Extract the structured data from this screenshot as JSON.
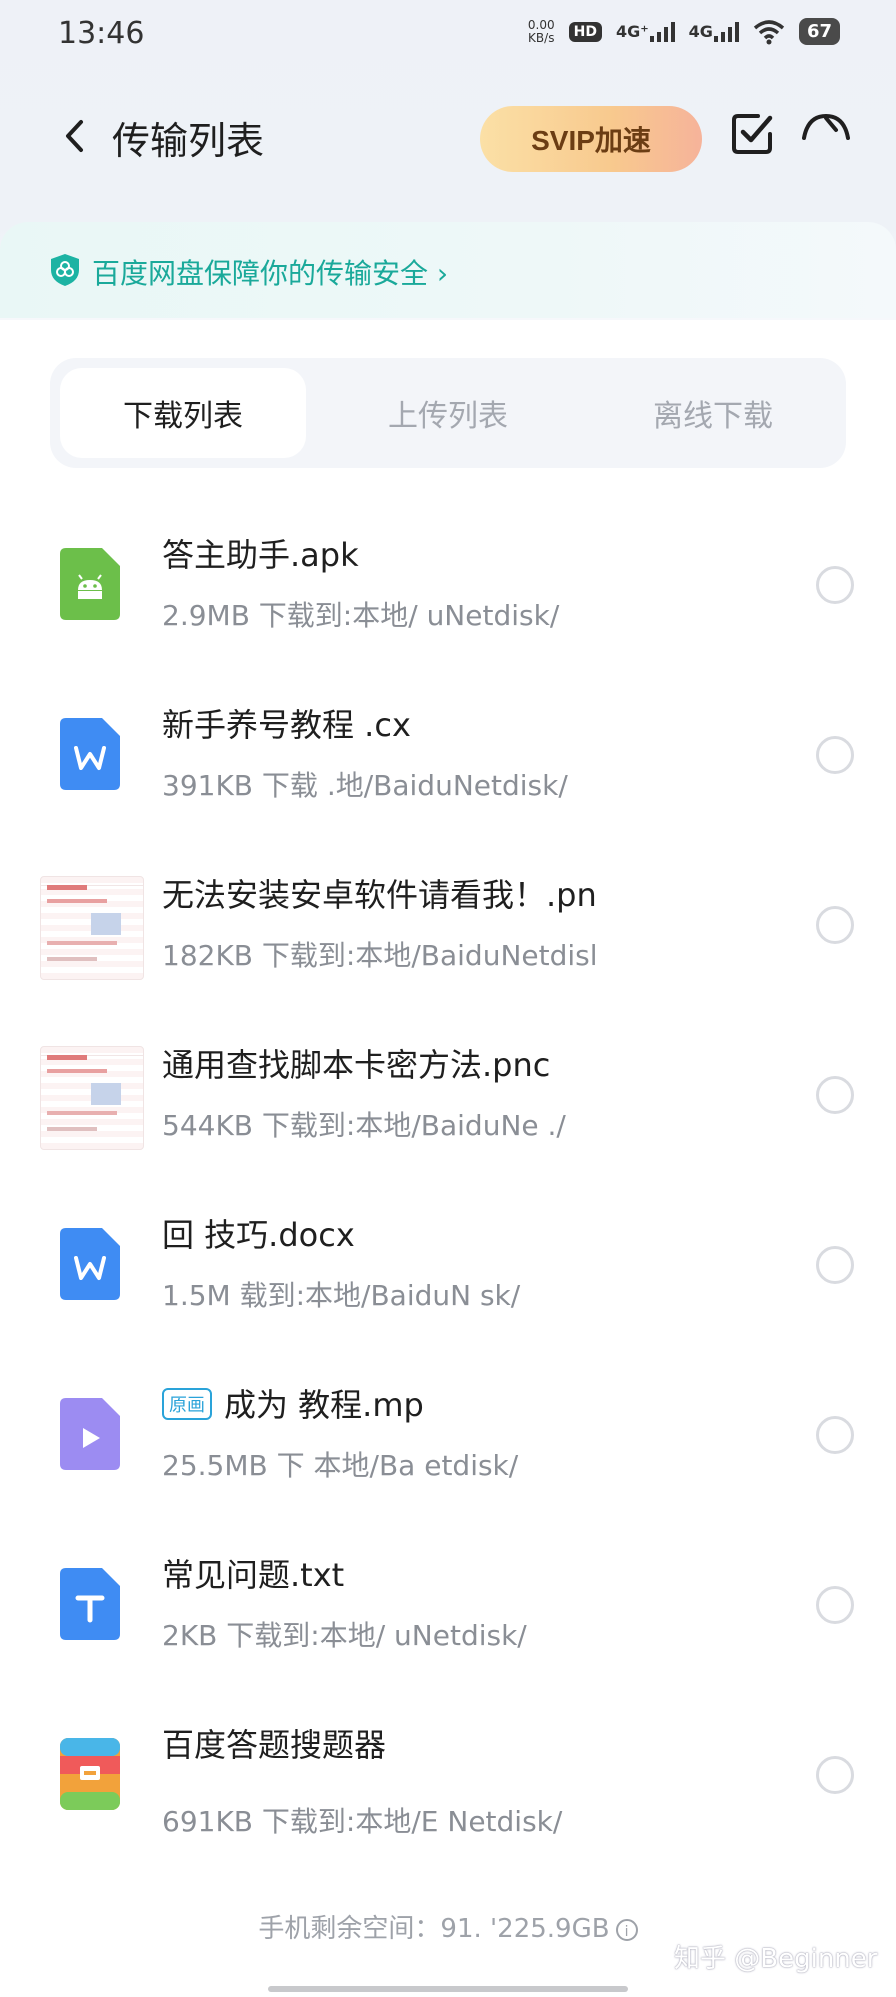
{
  "status_bar": {
    "time": "13:46",
    "net_speed_value": "0.00",
    "net_speed_unit": "KB/s",
    "hd_label": "HD",
    "signal1_label": "4G⁺",
    "signal2_label": "4G",
    "battery": "67"
  },
  "header": {
    "title": "传输列表",
    "svip_label": "SVIP加速"
  },
  "security_banner": {
    "text": "百度网盘保障你的传输安全 ›"
  },
  "tabs": [
    {
      "label": "下载列表",
      "active": true
    },
    {
      "label": "上传列表",
      "active": false
    },
    {
      "label": "离线下载",
      "active": false
    }
  ],
  "files": [
    {
      "name": "答主助手.apk",
      "meta": "2.9MB 下载到:本地/ uNetdisk/",
      "icon": "android-apk-icon",
      "color": "#6cbf4a"
    },
    {
      "name": "新手养号教程 .cx",
      "meta": "391KB 下载 .地/BaiduNetdisk/",
      "icon": "word-doc-icon",
      "color": "#3f8cf3"
    },
    {
      "name": "无法安装安卓软件请看我！.pn",
      "meta": "182KB 下载到:本地/BaiduNetdisl",
      "icon": "image-thumbnail",
      "color": "#e07b7b"
    },
    {
      "name": "通用查找脚本卡密方法.pnc",
      "meta": "544KB 下载到:本地/BaiduNe ./",
      "icon": "image-thumbnail",
      "color": "#e07b7b"
    },
    {
      "name": "回 技巧.docx",
      "meta": "1.5M 载到:本地/BaiduN sk/",
      "icon": "word-doc-icon",
      "color": "#3f8cf3"
    },
    {
      "name": "成为 教程.mp",
      "badge": "原画",
      "meta": "25.5MB 下 本地/Ba etdisk/",
      "icon": "video-file-icon",
      "color": "#9c8cf2"
    },
    {
      "name": "常见问题.txt",
      "meta": "2KB 下载到:本地/ uNetdisk/",
      "icon": "text-file-icon",
      "color": "#3f8cf3"
    },
    {
      "name": "百度答题搜题器",
      "meta": "691KB 下载到:本地/E Netdisk/",
      "icon": "archive-file-icon",
      "color": "#f2a23b"
    }
  ],
  "storage": {
    "text": "手机剩余空间：91. '225.9GB"
  },
  "watermark": "知乎 @Beginner"
}
